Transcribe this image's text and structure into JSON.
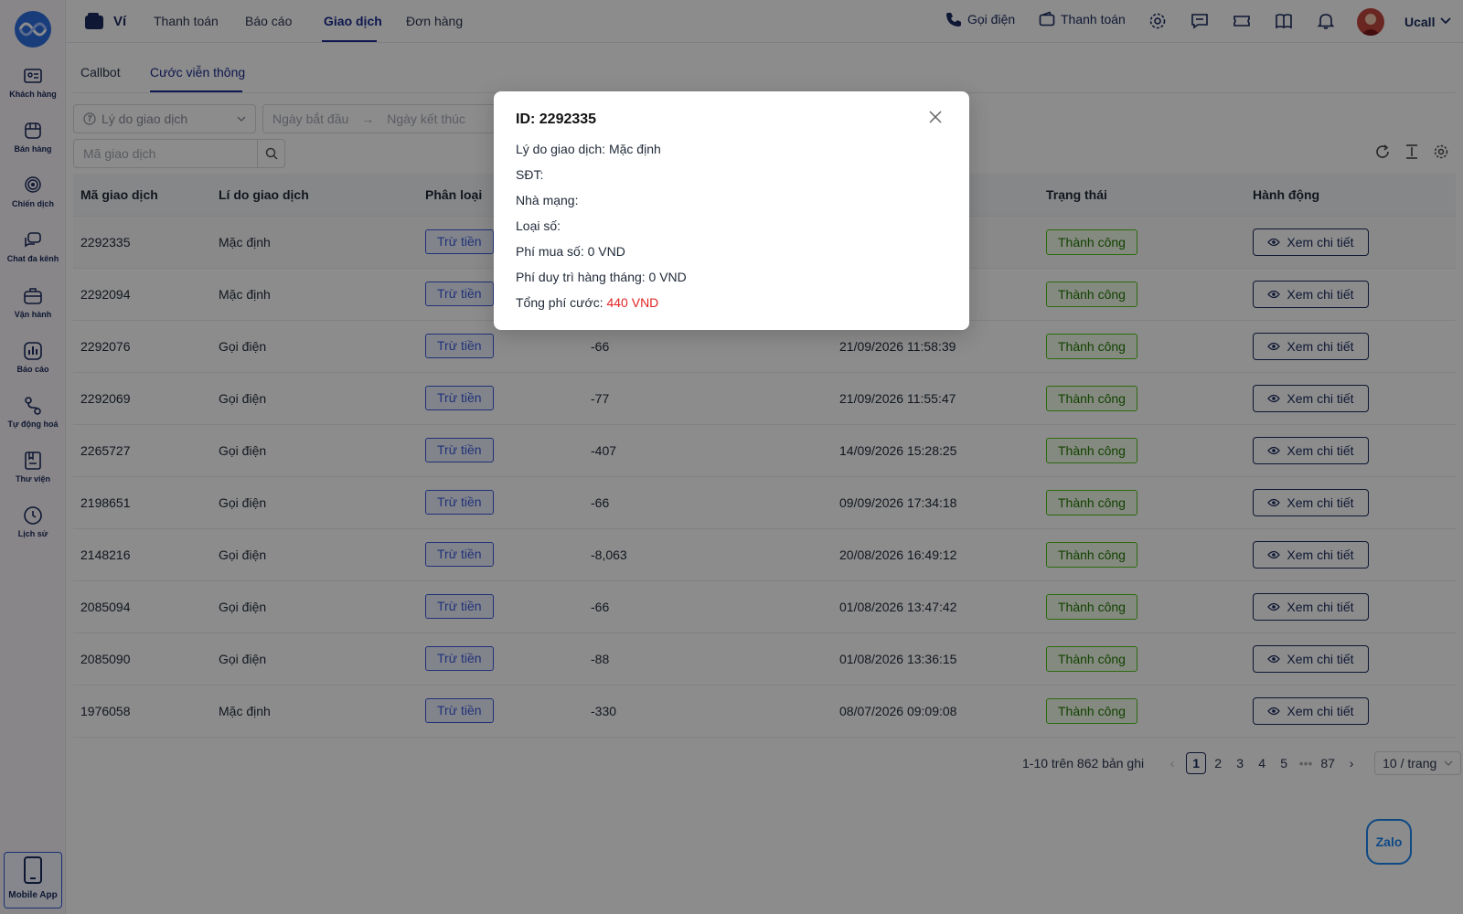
{
  "sidebar": {
    "items": [
      {
        "label": "Khách hàng",
        "icon": "contact-card-icon"
      },
      {
        "label": "Bán hàng",
        "icon": "store-icon"
      },
      {
        "label": "Chiến dịch",
        "icon": "broadcast-icon"
      },
      {
        "label": "Chat đa kênh",
        "icon": "chat-icon"
      },
      {
        "label": "Vận hành",
        "icon": "briefcase-icon"
      },
      {
        "label": "Báo cáo",
        "icon": "bar-chart-icon"
      },
      {
        "label": "Tự động hoá",
        "icon": "workflow-icon"
      },
      {
        "label": "Thư viện",
        "icon": "library-icon"
      },
      {
        "label": "Lịch sử",
        "icon": "clock-icon"
      }
    ],
    "mobile_app": "Mobile App"
  },
  "topbar": {
    "wallet_label": "Ví",
    "nav": [
      "Thanh toán",
      "Báo cáo",
      "Giao dịch",
      "Đơn hàng"
    ],
    "active_nav": "Giao dịch",
    "call_label": "Gọi điện",
    "pay_label": "Thanh toán",
    "user_name": "Ucall"
  },
  "subtabs": [
    "Callbot",
    "Cước viễn thông"
  ],
  "filters": {
    "reason_placeholder": "Lý do giao dịch",
    "start_placeholder": "Ngày bắt đầu",
    "end_placeholder": "Ngày kết thúc",
    "code_placeholder": "Mã giao dịch"
  },
  "table": {
    "headers": [
      "Mã giao dịch",
      "Lí do giao dịch",
      "Phân loại",
      "Trạng thái",
      "Hành động"
    ],
    "rows": [
      {
        "id": "2292335",
        "reason": "Mặc định",
        "type": "Trừ tiền",
        "amount": "",
        "time": "",
        "status": "Thành công",
        "action": "Xem chi tiết"
      },
      {
        "id": "2292094",
        "reason": "Mặc định",
        "type": "Trừ tiền",
        "amount": "",
        "time": "",
        "status": "Thành công",
        "action": "Xem chi tiết"
      },
      {
        "id": "2292076",
        "reason": "Gọi điện",
        "type": "Trừ tiền",
        "amount": "-66",
        "time": "21/09/2026 11:58:39",
        "status": "Thành công",
        "action": "Xem chi tiết"
      },
      {
        "id": "2292069",
        "reason": "Gọi điện",
        "type": "Trừ tiền",
        "amount": "-77",
        "time": "21/09/2026 11:55:47",
        "status": "Thành công",
        "action": "Xem chi tiết"
      },
      {
        "id": "2265727",
        "reason": "Gọi điện",
        "type": "Trừ tiền",
        "amount": "-407",
        "time": "14/09/2026 15:28:25",
        "status": "Thành công",
        "action": "Xem chi tiết"
      },
      {
        "id": "2198651",
        "reason": "Gọi điện",
        "type": "Trừ tiền",
        "amount": "-66",
        "time": "09/09/2026 17:34:18",
        "status": "Thành công",
        "action": "Xem chi tiết"
      },
      {
        "id": "2148216",
        "reason": "Gọi điện",
        "type": "Trừ tiền",
        "amount": "-8,063",
        "time": "20/08/2026 16:49:12",
        "status": "Thành công",
        "action": "Xem chi tiết"
      },
      {
        "id": "2085094",
        "reason": "Gọi điện",
        "type": "Trừ tiền",
        "amount": "-66",
        "time": "01/08/2026 13:47:42",
        "status": "Thành công",
        "action": "Xem chi tiết"
      },
      {
        "id": "2085090",
        "reason": "Gọi điện",
        "type": "Trừ tiền",
        "amount": "-88",
        "time": "01/08/2026 13:36:15",
        "status": "Thành công",
        "action": "Xem chi tiết"
      },
      {
        "id": "1976058",
        "reason": "Mặc định",
        "type": "Trừ tiền",
        "amount": "-330",
        "time": "08/07/2026 09:09:08",
        "status": "Thành công",
        "action": "Xem chi tiết"
      }
    ]
  },
  "pagination": {
    "summary": "1-10 trên 862 bản ghi",
    "pages": [
      "1",
      "2",
      "3",
      "4",
      "5",
      "•••",
      "87"
    ],
    "current": "1",
    "page_size": "10 / trang"
  },
  "zalo_label": "Zalo",
  "modal": {
    "title": "ID: 2292335",
    "reason": "Lý do giao dịch: Mặc định",
    "phone": "SĐT:",
    "carrier": "Nhà mạng:",
    "number_type": "Loại số:",
    "purchase_fee": "Phí mua số: 0 VND",
    "monthly_fee": "Phí duy trì hàng tháng: 0 VND",
    "total_label": "Tổng phí cước:",
    "total_value": "440 VND"
  },
  "colors": {
    "brand": "#1a2a5e",
    "accent": "#3b5bdb",
    "success": "#52c41a",
    "danger": "#e02424"
  }
}
